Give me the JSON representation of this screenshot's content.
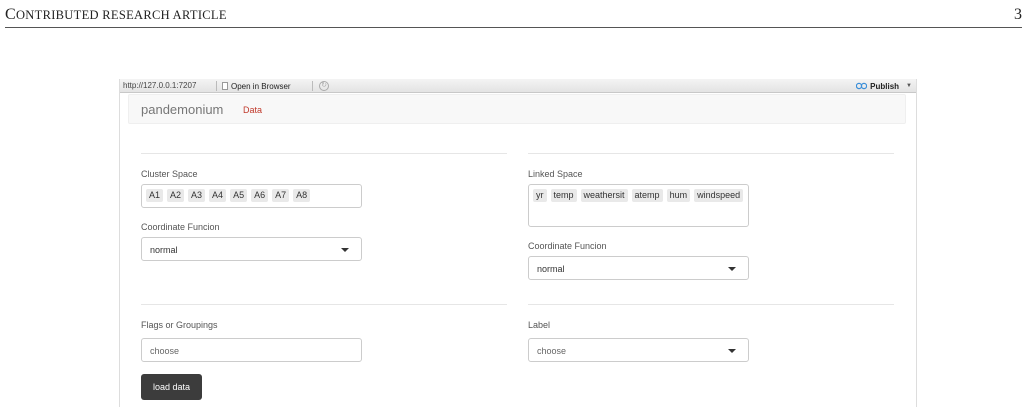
{
  "paper": {
    "title_cap1": "C",
    "title_rest1": "ONTRIBUTED RESEARCH ARTICLE",
    "page_number": "3"
  },
  "toolbar": {
    "url": "http://127.0.0.1:7207",
    "open_in_browser": "Open in Browser",
    "publish": "Publish"
  },
  "navbar": {
    "brand": "pandemonium",
    "tab": "Data"
  },
  "left": {
    "cluster_label": "Cluster Space",
    "cluster_items": [
      "A1",
      "A2",
      "A3",
      "A4",
      "A5",
      "A6",
      "A7",
      "A8"
    ],
    "coord_label": "Coordinate Funcion",
    "coord_value": "normal",
    "flags_label": "Flags or Groupings",
    "flags_placeholder": "choose",
    "load_button": "load data"
  },
  "right": {
    "linked_label": "Linked Space",
    "linked_items": [
      "yr",
      "temp",
      "weathersit",
      "atemp",
      "hum",
      "windspeed"
    ],
    "coord_label": "Coordinate Funcion",
    "coord_value": "normal",
    "label_label": "Label",
    "label_placeholder": "choose"
  },
  "colors": {
    "tab_active": "#c0392b",
    "button_dark": "#3c3c3c",
    "publish_icon": "#3b8fd9"
  }
}
